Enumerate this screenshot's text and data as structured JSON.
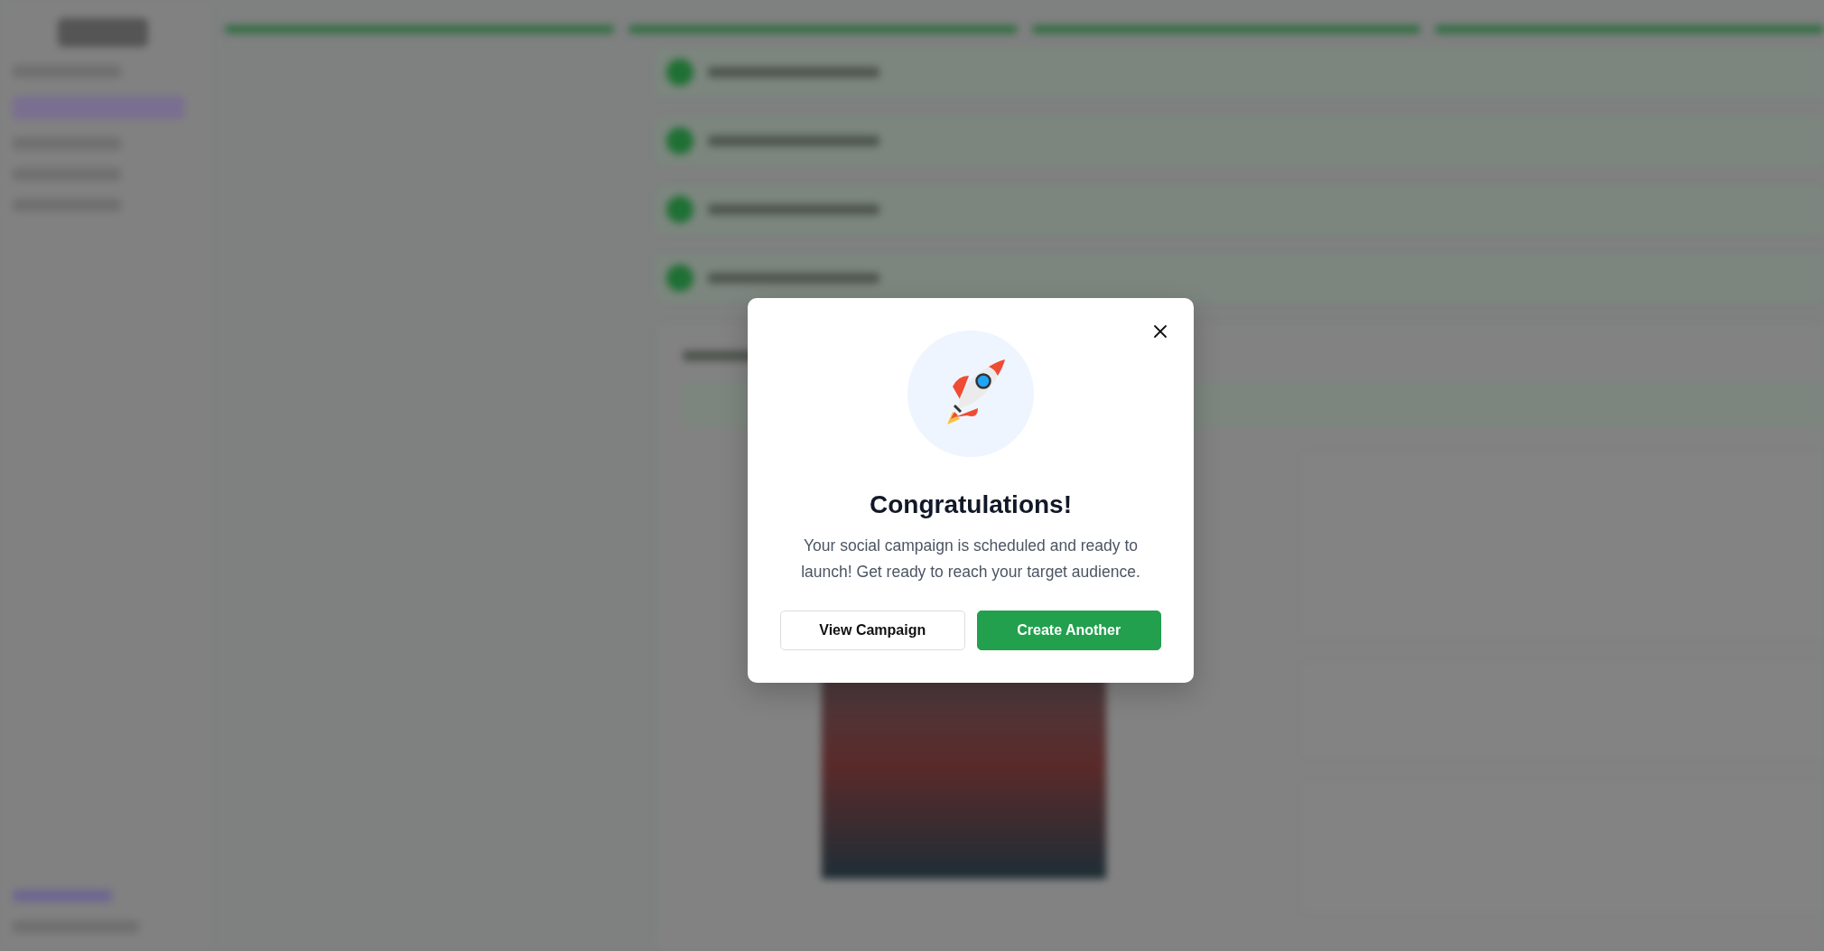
{
  "modal": {
    "title": "Congratulations!",
    "message": "Your social campaign is scheduled and ready to launch! Get ready to reach your target audience.",
    "buttons": [
      {
        "label": "View Campaign",
        "kind": "secondary"
      },
      {
        "label": "Create Another",
        "kind": "primary"
      }
    ]
  }
}
